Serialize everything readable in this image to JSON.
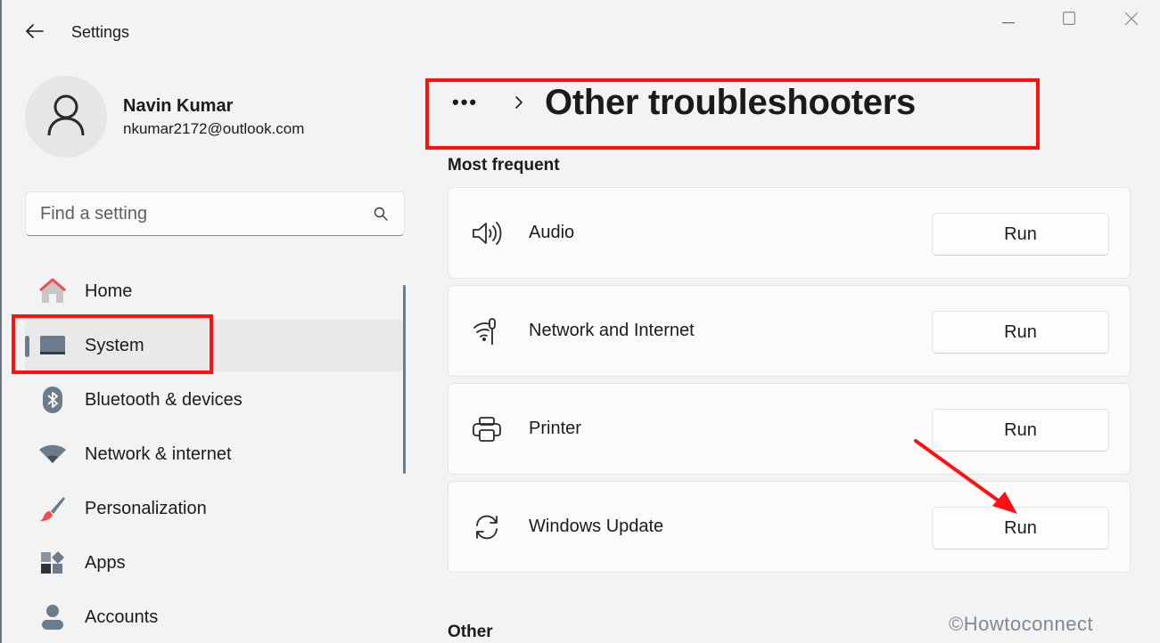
{
  "window": {
    "title": "Settings",
    "back_icon": "arrow-left-icon",
    "controls": {
      "minimize_icon": "minimize-icon",
      "maximize_icon": "maximize-icon",
      "close_icon": "close-icon"
    }
  },
  "profile": {
    "name": "Navin Kumar",
    "email": "nkumar2172@outlook.com",
    "avatar_icon": "person-icon"
  },
  "search": {
    "placeholder": "Find a setting",
    "value": "",
    "icon": "search-icon"
  },
  "sidebar": {
    "items": [
      {
        "label": "Home",
        "icon": "home-icon",
        "selected": false
      },
      {
        "label": "System",
        "icon": "system-icon",
        "selected": true
      },
      {
        "label": "Bluetooth & devices",
        "icon": "bluetooth-icon",
        "selected": false
      },
      {
        "label": "Network & internet",
        "icon": "wifi-icon",
        "selected": false
      },
      {
        "label": "Personalization",
        "icon": "brush-icon",
        "selected": false
      },
      {
        "label": "Apps",
        "icon": "apps-icon",
        "selected": false
      },
      {
        "label": "Accounts",
        "icon": "account-icon",
        "selected": false
      }
    ]
  },
  "breadcrumb": {
    "more": "•••",
    "separator_icon": "chevron-right-icon",
    "title": "Other troubleshooters"
  },
  "sections": {
    "most_frequent": {
      "title": "Most frequent",
      "items": [
        {
          "label": "Audio",
          "icon": "speaker-icon",
          "button": "Run"
        },
        {
          "label": "Network and Internet",
          "icon": "network-icon",
          "button": "Run"
        },
        {
          "label": "Printer",
          "icon": "printer-icon",
          "button": "Run"
        },
        {
          "label": "Windows Update",
          "icon": "sync-icon",
          "button": "Run"
        }
      ]
    },
    "other": {
      "title": "Other"
    }
  },
  "annotations": {
    "highlight_color": "#ff1010",
    "arrow_target": "Windows Update Run button"
  },
  "watermark": "©Howtoconnect",
  "colors": {
    "accent": "#6b7d8c",
    "background": "#f3f3f3",
    "card": "#fbfbfb"
  }
}
